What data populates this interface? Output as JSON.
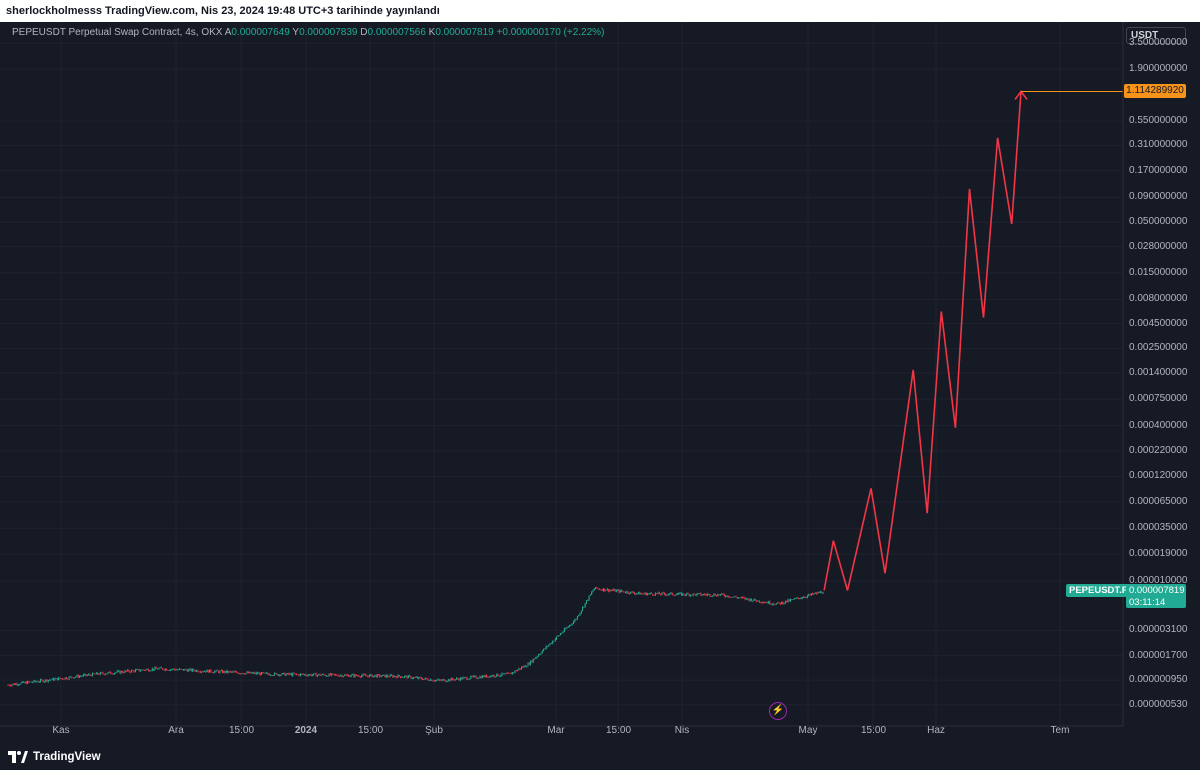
{
  "header": {
    "publisher": "sherlockholmesss TradingView.com, Nis 23, 2024 19:48 UTC+3 tarihinde yayınlandı"
  },
  "legend": {
    "symbol": "PEPEUSDT Perpetual Swap Contract, 4s, OKX",
    "open_label": "A",
    "open": "0.000007649",
    "high_label": "Y",
    "high": "0.000007839",
    "low_label": "D",
    "low": "0.000007566",
    "close_label": "K",
    "close": "0.000007819",
    "change": "+0.000000170 (+2.22%)"
  },
  "currency": "USDT",
  "price_axis_labels": [
    "3.500000000",
    "1.900000000",
    "1.114289920",
    "0.550000000",
    "0.310000000",
    "0.170000000",
    "0.090000000",
    "0.050000000",
    "0.028000000",
    "0.015000000",
    "0.008000000",
    "0.004500000",
    "0.002500000",
    "0.001400000",
    "0.000750000",
    "0.000400000",
    "0.000220000",
    "0.000120000",
    "0.000065000",
    "0.000035000",
    "0.000019000",
    "0.000010000",
    "0.000003100",
    "0.000001700",
    "0.000000950",
    "0.000000530"
  ],
  "time_axis_labels": [
    "Kas",
    "Ara",
    "15:00",
    "2024",
    "15:00",
    "Şub",
    "Mar",
    "15:00",
    "Nis",
    "May",
    "15:00",
    "Haz",
    "Tem"
  ],
  "target_label": "1.114289920",
  "symbol_tag": "PEPEUSDT.P",
  "last_price": "0.000007819",
  "countdown": "03:11:14",
  "footer": {
    "brand": "TradingView"
  },
  "colors": {
    "background": "#161a25",
    "grid": "#1f2330",
    "up_candle": "#22ab94",
    "down_candle": "#f23645",
    "projection": "#f23645",
    "target_line": "#f7931a"
  },
  "chart_data": {
    "type": "line",
    "scale": "log",
    "title": "",
    "xlabel": "",
    "ylabel": "",
    "grid": true,
    "series": [
      {
        "name": "PEPEUSDT.P",
        "x": [
          "Kas 1",
          "Kas 20",
          "Ara 3",
          "Ara 26",
          "Oca 24",
          "Şub 1",
          "Şub 16",
          "Şub 20",
          "Mar 1",
          "Mar 5",
          "Mar 15",
          "Nis 1",
          "Nis 13",
          "Nis 23"
        ],
        "values": [
          8.5e-07,
          1.1e-06,
          1.25e-06,
          1.1e-06,
          1.04e-06,
          9.4e-07,
          1.1e-06,
          1.4e-06,
          4e-06,
          8.4e-06,
          7.4e-06,
          7.2e-06,
          5.8e-06,
          7.819e-06
        ]
      },
      {
        "name": "",
        "x": [
          "Nis 23",
          "Nis 25",
          "Nis 28",
          "May 3",
          "May 6",
          "May 12",
          "May 15",
          "May 18",
          "May 21",
          "May 24",
          "May 27",
          "May 30",
          "Haz 2",
          "Haz 4",
          "Haz 7"
        ],
        "values": [
          8e-06,
          2.6e-05,
          8e-06,
          9e-05,
          1.2e-05,
          0.0015,
          5e-05,
          0.006,
          0.00038,
          0.11,
          0.0052,
          0.37,
          0.048,
          1.11428992,
          1.11428992
        ]
      }
    ],
    "annotations": [
      {
        "text": "1.114289920",
        "type": "horizontal-target",
        "value": 1.11428992
      }
    ]
  }
}
